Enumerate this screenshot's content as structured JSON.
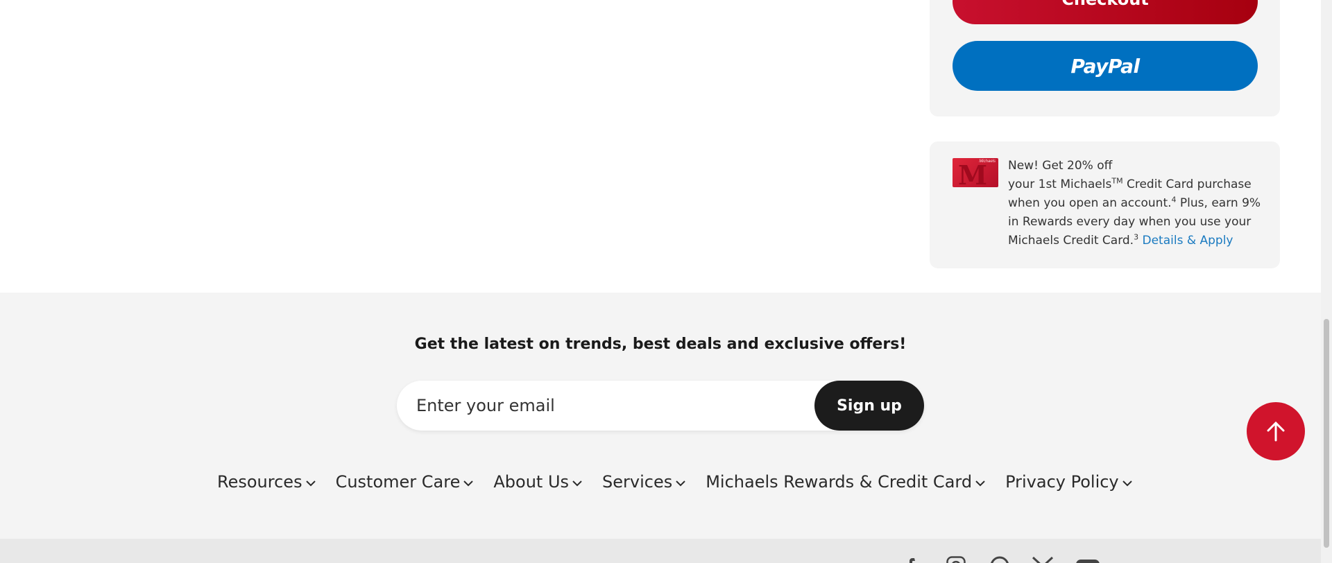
{
  "order_summary": {
    "checkout_label": "Checkout",
    "paypal_label": "PayPal"
  },
  "promo": {
    "line1": "New! Get 20% off",
    "line2_pre": "your 1st Michaels",
    "tm": "TM",
    "line2_post": " Credit Card purchase when you open an account.",
    "sup4": "4",
    "line3": " Plus, earn 9% in Rewards every day when you use your Michaels Credit Card.",
    "sup3": "3",
    "link": "Details & Apply",
    "card_brand": "Michaels"
  },
  "newsletter": {
    "heading": "Get the latest on trends, best deals and exclusive offers!",
    "email_placeholder": "Enter your email",
    "signup_label": "Sign up"
  },
  "footer_nav": [
    {
      "label": "Resources"
    },
    {
      "label": "Customer Care"
    },
    {
      "label": "About Us"
    },
    {
      "label": "Services"
    },
    {
      "label": "Michaels Rewards & Credit Card"
    },
    {
      "label": "Privacy Policy"
    }
  ],
  "colors": {
    "brand_red": "#d0142c",
    "paypal_blue": "#0070c0",
    "link_blue": "#1a7ac0"
  },
  "icons": [
    "arrow-up-icon",
    "chevron-down-icon",
    "facebook-icon",
    "instagram-icon",
    "pinterest-icon",
    "x-icon",
    "youtube-icon"
  ]
}
